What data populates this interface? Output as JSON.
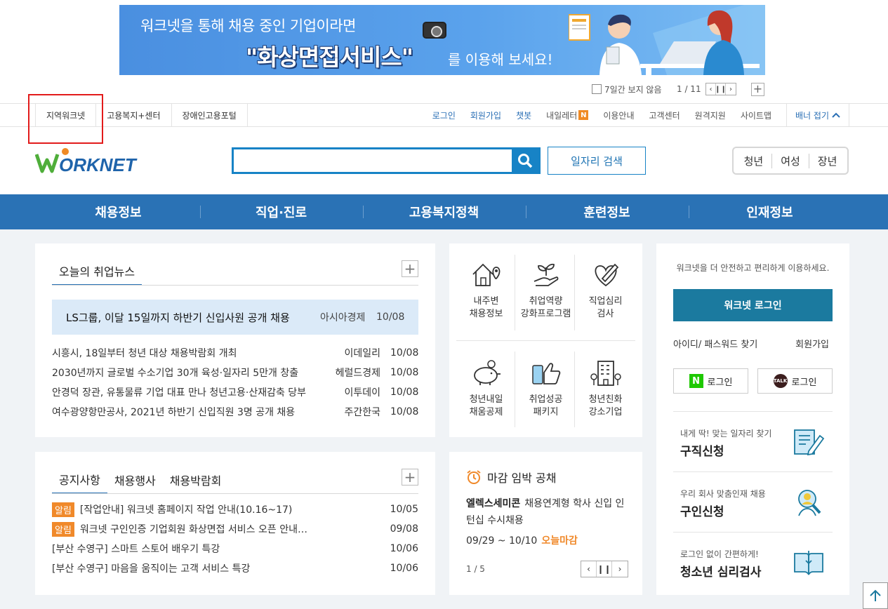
{
  "banner": {
    "line1": "워크넷을 통해 채용 중인 기업이라면",
    "line2": "\"화상면접서비스\"",
    "line2b": "를 이용해 보세요!",
    "hide_7days": "7일간 보지 않음",
    "counter": "1 / 11"
  },
  "util": {
    "left": [
      "지역워크넷",
      "고용복지+센터",
      "장애인고용포털"
    ],
    "login": "로그인",
    "signup": "회원가입",
    "chatbot": "챗봇",
    "letter": "내일레터",
    "letter_badge": "N",
    "guide": "이용안내",
    "customer": "고객센터",
    "remote": "원격지원",
    "sitemap": "사이트맵",
    "fold": "배너 접기"
  },
  "header": {
    "logo": "WORKNET",
    "search_placeholder": "",
    "job_search": "일자리 검색",
    "audience": [
      "청년",
      "여성",
      "장년"
    ]
  },
  "gnb": [
    "채용정보",
    "직업·진로",
    "고용복지정책",
    "훈련정보",
    "인재정보"
  ],
  "news": {
    "tab": "오늘의 취업뉴스",
    "headline": {
      "title": "LS그룹, 이달 15일까지 하반기 신입사원 공개 채용",
      "source": "아시아경제",
      "date": "10/08"
    },
    "items": [
      {
        "title": "시흥시, 18일부터 청년 대상 채용박람회 개최",
        "source": "이데일리",
        "date": "10/08"
      },
      {
        "title": "2030년까지 글로벌 수소기업 30개 육성·일자리 5만개 창출",
        "source": "헤럴드경제",
        "date": "10/08"
      },
      {
        "title": "안경덕 장관, 유통물류 기업 대표 만나 청년고용·산재감축 당부",
        "source": "이투데이",
        "date": "10/08"
      },
      {
        "title": "여수광양항만공사, 2021년 하반기 신입직원 3명 공개 채용",
        "source": "주간한국",
        "date": "10/08"
      }
    ]
  },
  "quick": [
    {
      "line1": "내주변",
      "line2": "채용정보"
    },
    {
      "line1": "취업역량",
      "line2": "강화프로그램"
    },
    {
      "line1": "직업심리",
      "line2": "검사"
    },
    {
      "line1": "청년내일",
      "line2": "채움공제"
    },
    {
      "line1": "취업성공",
      "line2": "패키지"
    },
    {
      "line1": "청년친화",
      "line2": "강소기업"
    }
  ],
  "login_panel": {
    "msg": "워크넷을 더 안전하고 편리하게 이용하세요.",
    "login_btn": "워크넷 로그인",
    "find": "아이디/ 패스워드 찾기",
    "join": "회원가입",
    "naver": "로그인",
    "naver_icon": "N",
    "kakao": "로그인",
    "kakao_icon": "TALK",
    "services": [
      {
        "sub": "내게 딱! 맞는 일자리 찾기",
        "main": "구직신청"
      },
      {
        "sub": "우리 회사 맞춤인재 채용",
        "main": "구인신청"
      },
      {
        "sub": "로그인 없이 간편하게!",
        "main": "청소년 심리검사"
      }
    ]
  },
  "notice": {
    "tabs": [
      "공지사항",
      "채용행사",
      "채용박람회"
    ],
    "items": [
      {
        "badge": "알림",
        "title": "[작업안내] 워크넷 홈페이지 작업 안내(10.16~17)",
        "date": "10/05"
      },
      {
        "badge": "알림",
        "title": "워크넷 구인인증 기업회원 화상면접 서비스 오픈 안내…",
        "date": "09/08"
      },
      {
        "badge": "",
        "title": "[부산 수영구] 스마트 스토어 배우기 특강",
        "date": "10/06"
      },
      {
        "badge": "",
        "title": "[부산 수영구] 마음을 움직이는 고객 서비스 특강",
        "date": "10/06"
      }
    ]
  },
  "deadline": {
    "title": "마감 임박 공채",
    "company": "엘렉스세미콘",
    "desc": "채용연계형 학사 신입 인턴십 수시채용",
    "period": "09/29 ~ 10/10",
    "today": "오늘마감",
    "page": "1 / 5"
  },
  "colors": {
    "primary": "#2a72b5",
    "accent": "#f0892a",
    "login": "#1b7a9f"
  }
}
